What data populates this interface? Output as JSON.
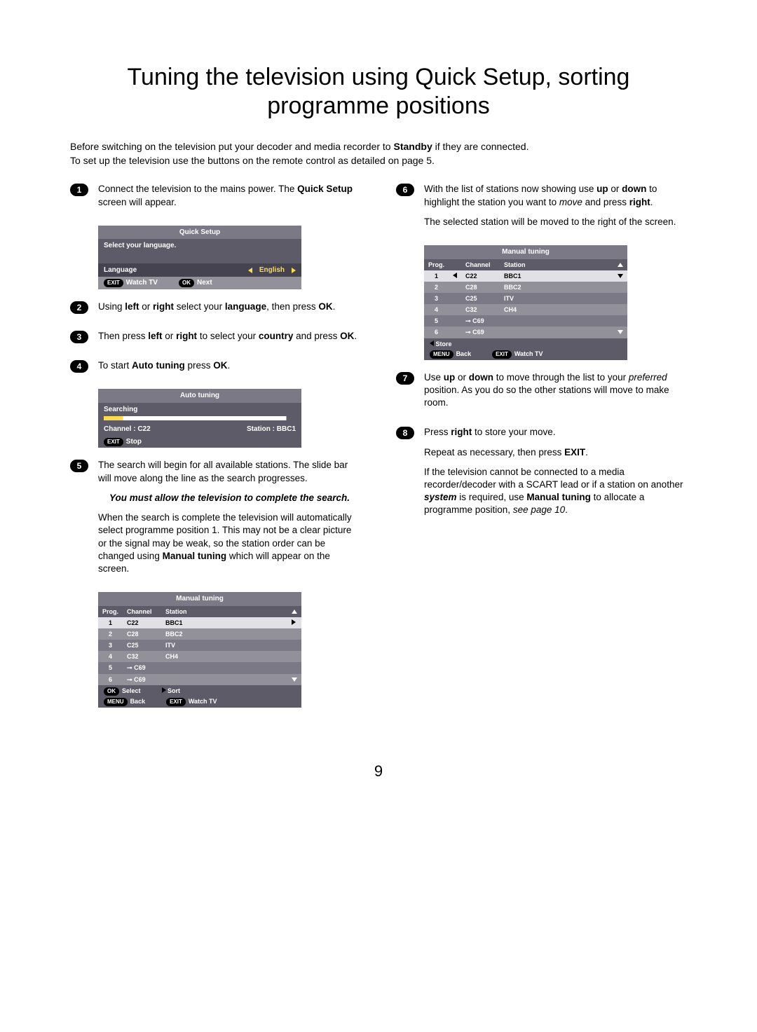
{
  "title": "Tuning the television using Quick Setup, sorting programme positions",
  "intro": {
    "line1_a": "Before switching on the television put your decoder and media recorder to ",
    "line1_b": "Standby",
    "line1_c": " if they are connected.",
    "line2": "To set up the television use the buttons on the remote control as detailed on page 5."
  },
  "steps": {
    "s1": {
      "num": "1",
      "a": "Connect the television to the mains power. The ",
      "b": "Quick Setup",
      "c": " screen will appear."
    },
    "s2": {
      "num": "2",
      "a": "Using ",
      "b": "left",
      "c": " or ",
      "d": "right",
      "e": " select your ",
      "f": "language",
      "g": ", then press ",
      "h": "OK",
      "i": "."
    },
    "s3": {
      "num": "3",
      "a": "Then press ",
      "b": "left",
      "c": " or ",
      "d": "right",
      "e": " to select your ",
      "f": "country",
      "g": " and press ",
      "h": "OK",
      "i": "."
    },
    "s4": {
      "num": "4",
      "a": "To start ",
      "b": "Auto tuning",
      "c": " press ",
      "d": "OK",
      "e": "."
    },
    "s5": {
      "num": "5",
      "p1": "The search will begin for all available stations. The slide bar will move along the line as the search progresses.",
      "note": "You must allow the television to complete the search.",
      "p2a": "When the search is complete the television will automatically select programme position 1. This may not be a clear picture or the signal may be weak, so the station order can be changed using ",
      "p2b": "Manual tuning",
      "p2c": " which will appear on the screen."
    },
    "s6": {
      "num": "6",
      "p1a": "With the list of stations now showing use ",
      "p1b": "up",
      "p1c": " or ",
      "p1d": "down",
      "p1e": " to highlight the station you want to ",
      "p1f": "move",
      "p1g": " and press ",
      "p1h": "right",
      "p1i": ".",
      "p2": "The selected station will be moved to the right of the screen."
    },
    "s7": {
      "num": "7",
      "a": "Use ",
      "b": "up",
      "c": " or ",
      "d": "down",
      "e": " to move through the list to your ",
      "f": "preferred",
      "g": " position. As you do so the other stations will move to make room."
    },
    "s8": {
      "num": "8",
      "p1a": "Press ",
      "p1b": "right",
      "p1c": " to store your move.",
      "p2a": "Repeat as necessary, then press ",
      "p2b": "EXIT",
      "p2c": ".",
      "p3a": "If the television cannot be connected to a media recorder/decoder with a SCART lead or if a station on another ",
      "p3b": "system",
      "p3c": " is required, use ",
      "p3d": "Manual tuning",
      "p3e": " to allocate a programme position, ",
      "p3f": "see page 10",
      "p3g": "."
    }
  },
  "osd_quick": {
    "title": "Quick Setup",
    "sub": "Select your language.",
    "lang_lbl": "Language",
    "lang_val": "English",
    "exit": "EXIT",
    "watch": "Watch TV",
    "ok": "OK",
    "next": "Next"
  },
  "osd_auto": {
    "title": "Auto tuning",
    "searching": "Searching",
    "chan_lbl": "Channel  :  C22",
    "stat_lbl": "Station : BBC1",
    "exit": "EXIT",
    "stop": "Stop"
  },
  "osd_mt1": {
    "title": "Manual tuning",
    "hdr": {
      "prog": "Prog.",
      "chan": "Channel",
      "stat": "Station"
    },
    "rows": [
      {
        "p": "1",
        "c": "C22",
        "s": "BBC1",
        "sel": true
      },
      {
        "p": "2",
        "c": "C28",
        "s": "BBC2"
      },
      {
        "p": "3",
        "c": "C25",
        "s": "ITV"
      },
      {
        "p": "4",
        "c": "C32",
        "s": "CH4"
      },
      {
        "p": "5",
        "c": "C69",
        "s": "",
        "key": true
      },
      {
        "p": "6",
        "c": "C69",
        "s": "",
        "key": true
      }
    ],
    "foot": {
      "ok": "OK",
      "select": "Select",
      "sort": "Sort",
      "menu": "MENU",
      "back": "Back",
      "exit": "EXIT",
      "watch": "Watch TV"
    }
  },
  "osd_mt2": {
    "title": "Manual tuning",
    "hdr": {
      "prog": "Prog.",
      "chan": "Channel",
      "stat": "Station"
    },
    "rows": [
      {
        "p": "1",
        "c": "C22",
        "s": "BBC1",
        "sel": true,
        "arrows": true
      },
      {
        "p": "2",
        "c": "C28",
        "s": "BBC2"
      },
      {
        "p": "3",
        "c": "C25",
        "s": "ITV"
      },
      {
        "p": "4",
        "c": "C32",
        "s": "CH4"
      },
      {
        "p": "5",
        "c": "C69",
        "s": "",
        "key": true
      },
      {
        "p": "6",
        "c": "C69",
        "s": "",
        "key": true
      }
    ],
    "foot": {
      "store": "Store",
      "menu": "MENU",
      "back": "Back",
      "exit": "EXIT",
      "watch": "Watch TV"
    }
  },
  "page_number": "9"
}
